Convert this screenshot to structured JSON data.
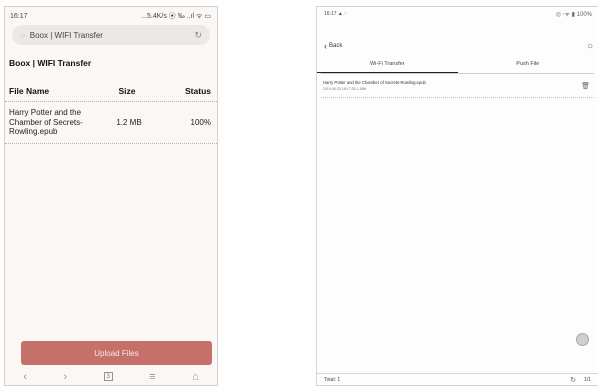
{
  "phone": {
    "status_bar": {
      "time": "16:17",
      "indicators": "...5.4K/s ⦿ ‰ ..ıl ᯤ ▭"
    },
    "url_bar": {
      "text": "Boox | WIFI Transfer",
      "left_icon": "page-icon",
      "right_icon": "reload-icon"
    },
    "page_title": "Boox | WIFI Transfer",
    "table": {
      "headers": [
        "File Name",
        "Size",
        "Status"
      ],
      "rows": [
        {
          "file_name": "Harry Potter and the Chamber of Secrets-Rowling.epub",
          "size": "1.2 MB",
          "status": "100%"
        }
      ]
    },
    "upload_button": "Upload Files",
    "upload_button_color": "#c6706a",
    "nav_bar": {
      "icons": [
        "back-icon",
        "forward-icon",
        "tabs-icon",
        "menu-icon",
        "home-icon"
      ],
      "tabs_count": "3"
    }
  },
  "tablet": {
    "status_bar": {
      "time": "16:17 ▲ ◌",
      "indicators": "◎ ⋅ᯤ ▮ 100%"
    },
    "back_label": "Back",
    "tabs": [
      "Wi-Fi Transfer",
      "Push File"
    ],
    "active_tab": "Wi-Fi Transfer",
    "files": [
      {
        "name": "Harry Potter and the Chamber of Secrets-Rowling.epub",
        "details": "2019-06-03 16:17:33  1.18M"
      }
    ],
    "footer": {
      "total": "Total: 1",
      "page": "1/1"
    }
  }
}
